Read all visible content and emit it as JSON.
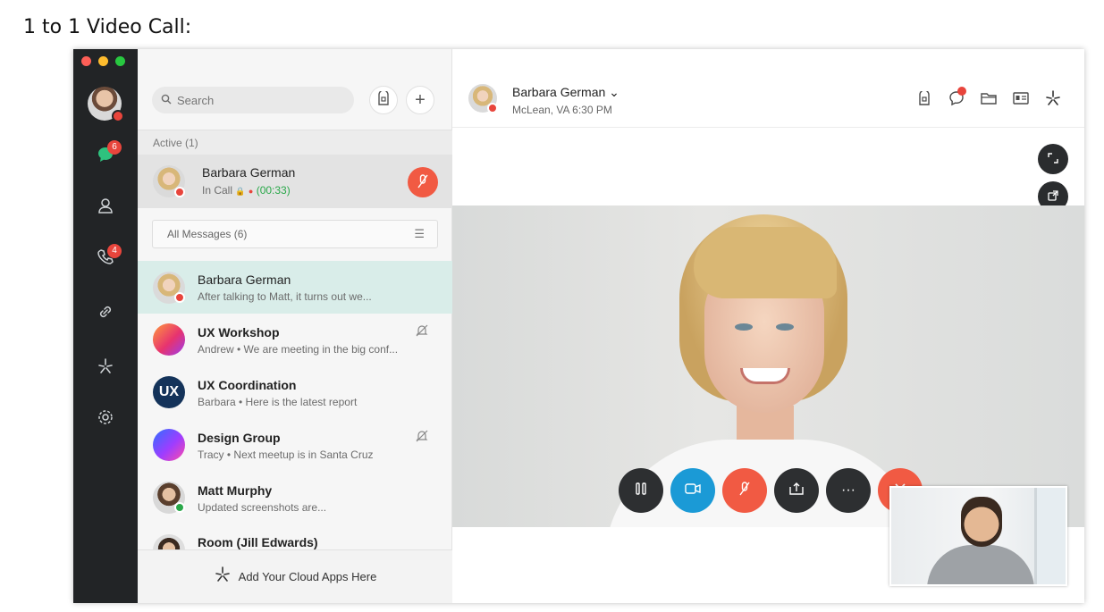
{
  "page": {
    "title": "1 to 1 Video Call:"
  },
  "rail": {
    "chat_badge": "6",
    "calls_badge": "4"
  },
  "search": {
    "placeholder": "Search"
  },
  "active_section": {
    "label": "Active (1)"
  },
  "active_call": {
    "name": "Barbara German",
    "status": "In Call",
    "timer": "(00:33)"
  },
  "filter": {
    "label": "All Messages (6)"
  },
  "messages": [
    {
      "title": "Barbara German",
      "preview": "After talking to Matt, it turns out we...",
      "muted": false
    },
    {
      "title": "UX Workshop",
      "preview": "Andrew • We are meeting in the big conf...",
      "muted": true
    },
    {
      "title": "UX Coordination",
      "preview": "Barbara • Here is the latest report",
      "avatar_text": "UX",
      "muted": false
    },
    {
      "title": "Design Group",
      "preview": "Tracy • Next meetup is in Santa Cruz",
      "muted": true
    },
    {
      "title": "Matt Murphy",
      "preview": "Updated screenshots are...",
      "muted": false
    },
    {
      "title": "Room (Jill Edwards)",
      "preview": "",
      "muted": false
    }
  ],
  "cloud_apps": {
    "label": "Add Your Cloud Apps Here"
  },
  "header": {
    "name": "Barbara German",
    "location": "McLean, VA 6:30 PM"
  },
  "colors": {
    "rail_bg": "#222426",
    "accent_red": "#f15a43",
    "accent_blue": "#1b9ad6",
    "selected_row": "#d9ede9",
    "online_green": "#2aa84a"
  },
  "icons": {
    "chat": "chat-icon",
    "contacts": "person-icon",
    "calls": "phone-icon",
    "link": "link-icon",
    "apps": "asterisk-icon",
    "settings": "gear-icon"
  }
}
